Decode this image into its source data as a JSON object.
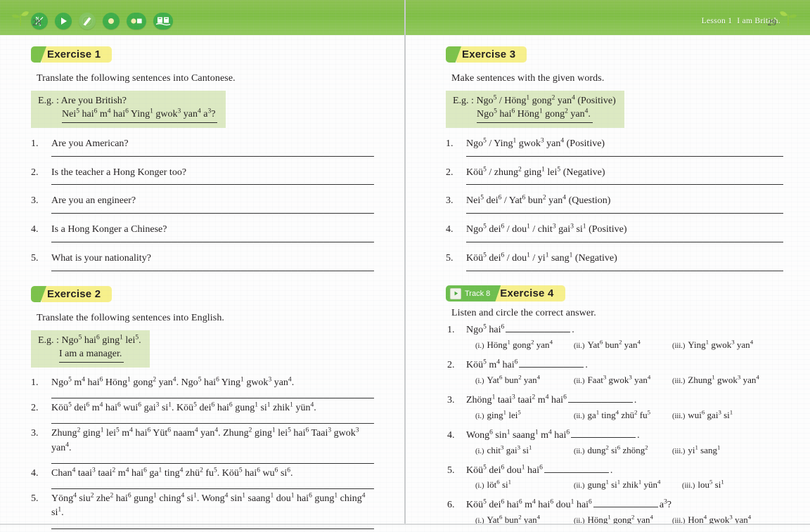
{
  "header": {
    "lesson_label": "Lesson 1",
    "lesson_title": "I am British.",
    "icons": [
      "fraction-ns-icon",
      "play-icon",
      "pencil-write-icon",
      "dot-circle-icon",
      "record-stop-icon",
      "book-icon"
    ]
  },
  "colors": {
    "header_green": "#7fbe45",
    "tag_green": "#7cc24a",
    "tag_yellow": "#f7f08b",
    "eg_box_green": "#dce9c2",
    "track_green": "#6dbe4e"
  },
  "left_page": {
    "page_number": "28",
    "exercise1": {
      "title": "Exercise 1",
      "instruction": "Translate the following sentences into Cantonese.",
      "example": {
        "line1": "E.g. : Are you British?",
        "line2_html": "Nei<sup>5</sup> hai<sup>6</sup> m<sup>4</sup> hai<sup>6</sup> Ying<sup>1</sup> gwok<sup>3</sup> yan<sup>4</sup> a<sup>3</sup>?"
      },
      "questions": [
        {
          "num": "1.",
          "text": "Are you American?"
        },
        {
          "num": "2.",
          "text": "Is the teacher a Hong Konger too?"
        },
        {
          "num": "3.",
          "text": "Are you an engineer?"
        },
        {
          "num": "4.",
          "text": "Is a Hong Konger a Chinese?"
        },
        {
          "num": "5.",
          "text": "What is your nationality?"
        }
      ]
    },
    "exercise2": {
      "title": "Exercise 2",
      "instruction": "Translate the following sentences into English.",
      "example": {
        "line1_html": "E.g. : Ngo<sup>5</sup> hai<sup>6</sup> ging<sup>1</sup> lei<sup>5</sup>.",
        "line2": "I am a manager."
      },
      "questions": [
        {
          "num": "1.",
          "html": "Ngo<sup>5</sup> m<sup>4</sup> hai<sup>6</sup> H&ouml;ng<sup>1</sup> gong<sup>2</sup> yan<sup>4</sup>. Ngo<sup>5</sup> hai<sup>6</sup> Ying<sup>1</sup> gwok<sup>3</sup> yan<sup>4</sup>."
        },
        {
          "num": "2.",
          "html": "K&ouml;&uuml;<sup>5</sup> dei<sup>6</sup> m<sup>4</sup> hai<sup>6</sup> wui<sup>6</sup> gai<sup>3</sup> si<sup>1</sup>. K&ouml;&uuml;<sup>5</sup> dei<sup>6</sup> hai<sup>6</sup> gung<sup>1</sup> si<sup>1</sup> zhik<sup>1</sup> y&uuml;n<sup>4</sup>."
        },
        {
          "num": "3.",
          "html": "Zhung<sup>2</sup> ging<sup>1</sup> lei<sup>5</sup> m<sup>4</sup> hai<sup>6</sup> Y&uuml;t<sup>6</sup> naam<sup>4</sup> yan<sup>4</sup>. Zhung<sup>2</sup> ging<sup>1</sup> lei<sup>5</sup> hai<sup>6</sup> Taai<sup>3</sup> gwok<sup>3</sup> yan<sup>4</sup>."
        },
        {
          "num": "4.",
          "html": "Chan<sup>4</sup> taai<sup>3</sup> taai<sup>2</sup> m<sup>4</sup> hai<sup>6</sup> ga<sup>1</sup> ting<sup>4</sup> zh&uuml;<sup>2</sup> fu<sup>5</sup>. K&ouml;&uuml;<sup>5</sup> hai<sup>6</sup> wu<sup>6</sup> si<sup>6</sup>."
        },
        {
          "num": "5.",
          "html": "Y&ouml;ng<sup>4</sup> siu<sup>2</sup> zhe<sup>2</sup> hai<sup>6</sup> gung<sup>1</sup> ching<sup>4</sup> si<sup>1</sup>. Wong<sup>4</sup> sin<sup>1</sup> saang<sup>1</sup> dou<sup>1</sup> hai<sup>6</sup> gung<sup>1</sup> ching<sup>4</sup> si<sup>1</sup>."
        }
      ]
    }
  },
  "right_page": {
    "page_number": "29",
    "exercise3": {
      "title": "Exercise 3",
      "instruction": "Make sentences with the given words.",
      "example": {
        "line1_html": "E.g. : Ngo<sup>5</sup> / H&ouml;ng<sup>1</sup> gong<sup>2</sup> yan<sup>4</sup> (Positive)",
        "line2_html": "Ngo<sup>5</sup> hai<sup>6</sup> H&ouml;ng<sup>1</sup> gong<sup>2</sup> yan<sup>4</sup>."
      },
      "questions": [
        {
          "num": "1.",
          "html": "Ngo<sup>5</sup> / Ying<sup>1</sup> gwok<sup>3</sup> yan<sup>4</sup> (Positive)"
        },
        {
          "num": "2.",
          "html": "K&ouml;&uuml;<sup>5</sup> / zhung<sup>2</sup> ging<sup>1</sup> lei<sup>5</sup> (Negative)"
        },
        {
          "num": "3.",
          "html": "Nei<sup>5</sup> dei<sup>6</sup> / Yat<sup>6</sup> bun<sup>2</sup> yan<sup>4</sup> (Question)"
        },
        {
          "num": "4.",
          "html": "Ngo<sup>5</sup> dei<sup>6</sup> / dou<sup>1</sup> / chit<sup>3</sup> gai<sup>3</sup> si<sup>1</sup> (Positive)"
        },
        {
          "num": "5.",
          "html": "K&ouml;&uuml;<sup>5</sup> dei<sup>6</sup> / dou<sup>1</sup> / yi<sup>1</sup> sang<sup>1</sup> (Negative)"
        }
      ]
    },
    "exercise4": {
      "track_label": "Track 8",
      "title": "Exercise 4",
      "instruction": "Listen and circle the correct answer.",
      "questions": [
        {
          "num": "1.",
          "stem_before_html": "Ngo<sup>5</sup> hai<sup>6</sup>",
          "stem_after": ".",
          "options": [
            {
              "marker": "(i.)",
              "html": "H&ouml;ng<sup>1</sup> gong<sup>2</sup> yan<sup>4</sup>"
            },
            {
              "marker": "(ii.)",
              "html": "Yat<sup>6</sup> bun<sup>2</sup> yan<sup>4</sup>"
            },
            {
              "marker": "(iii.)",
              "html": "Ying<sup>1</sup> gwok<sup>3</sup> yan<sup>4</sup>"
            }
          ]
        },
        {
          "num": "2.",
          "stem_before_html": "K&ouml;&uuml;<sup>5</sup> m<sup>4</sup> hai<sup>6</sup>",
          "stem_after": ".",
          "options": [
            {
              "marker": "(i.)",
              "html": "Yat<sup>6</sup> bun<sup>2</sup> yan<sup>4</sup>"
            },
            {
              "marker": "(ii.)",
              "html": "Faat<sup>3</sup> gwok<sup>3</sup> yan<sup>4</sup>"
            },
            {
              "marker": "(iii.)",
              "html": "Zhung<sup>1</sup> gwok<sup>3</sup> yan<sup>4</sup>"
            }
          ]
        },
        {
          "num": "3.",
          "stem_before_html": "Zh&ouml;ng<sup>1</sup> taai<sup>3</sup> taai<sup>2</sup> m<sup>4</sup> hai<sup>6</sup>",
          "stem_after": ".",
          "options": [
            {
              "marker": "(i.)",
              "html": "ging<sup>1</sup> lei<sup>5</sup>"
            },
            {
              "marker": "(ii.)",
              "html": "ga<sup>1</sup> ting<sup>4</sup> zh&uuml;<sup>2</sup> fu<sup>5</sup>"
            },
            {
              "marker": "(iii.)",
              "html": "wui<sup>6</sup> gai<sup>3</sup> si<sup>1</sup>"
            }
          ]
        },
        {
          "num": "4.",
          "stem_before_html": "Wong<sup>6</sup> sin<sup>1</sup> saang<sup>1</sup> m<sup>4</sup> hai<sup>6</sup>",
          "stem_after": ".",
          "options": [
            {
              "marker": "(i.)",
              "html": "chit<sup>3</sup> gai<sup>3</sup> si<sup>1</sup>"
            },
            {
              "marker": "(ii.)",
              "html": "dung<sup>2</sup> si<sup>6</sup> zh&ouml;ng<sup>2</sup>"
            },
            {
              "marker": "(iii.)",
              "html": "yi<sup>1</sup> sang<sup>1</sup>"
            }
          ]
        },
        {
          "num": "5.",
          "stem_before_html": "K&ouml;&uuml;<sup>5</sup> dei<sup>6</sup> dou<sup>1</sup> hai<sup>6</sup>",
          "stem_after": ".",
          "options": [
            {
              "marker": "(i.)",
              "html": "l&ouml;t<sup>6</sup> si<sup>1</sup>"
            },
            {
              "marker": "(ii.)",
              "html": "gung<sup>1</sup> si<sup>1</sup> zhik<sup>1</sup> y&uuml;n<sup>4</sup>"
            },
            {
              "marker": "(iii.)",
              "html": "lou<sup>5</sup> si<sup>1</sup>"
            }
          ]
        },
        {
          "num": "6.",
          "stem_before_html": "K&ouml;&uuml;<sup>5</sup> dei<sup>6</sup> hai<sup>6</sup> m<sup>4</sup> hai<sup>6</sup> dou<sup>1</sup> hai<sup>6</sup>",
          "stem_after_html": "a<sup>3</sup>?",
          "options": [
            {
              "marker": "(i.)",
              "html": "Yat<sup>6</sup> bun<sup>2</sup> yan<sup>4</sup>"
            },
            {
              "marker": "(ii.)",
              "html": "H&ouml;ng<sup>1</sup> gong<sup>2</sup> yan<sup>4</sup>"
            },
            {
              "marker": "(iii.)",
              "html": "Hon<sup>4</sup> gwok<sup>3</sup> yan<sup>4</sup>"
            }
          ]
        }
      ]
    }
  }
}
